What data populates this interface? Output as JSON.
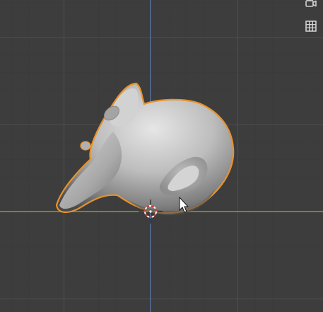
{
  "viewport": {
    "background_color": "#3d3d3d",
    "grid_color": "#505050",
    "x_axis_color": "#6c8a33",
    "y_axis_color": "#4f72b0",
    "selection_outline_color": "#e8922a"
  },
  "gizmos": {
    "camera_icon": "camera-view-icon",
    "ortho_icon": "grid-perspective-icon"
  },
  "scene_object": {
    "icon": "monkey-head-mesh",
    "selected": true
  },
  "cursor_3d": {
    "icon": "3d-cursor-icon"
  },
  "mouse_pointer": {
    "icon": "arrow-cursor-icon"
  }
}
